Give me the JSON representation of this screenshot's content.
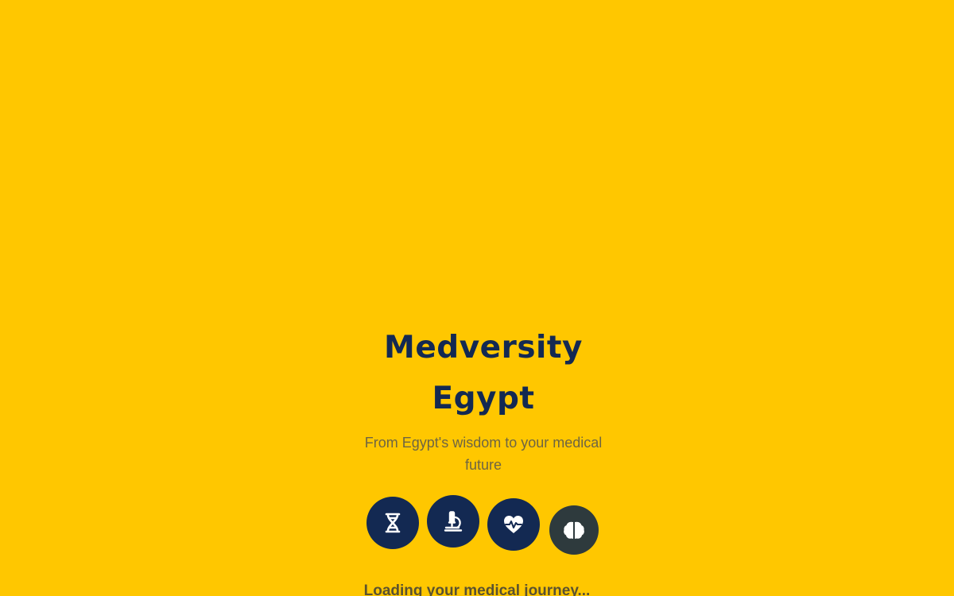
{
  "app": {
    "title_line1": "Medversity",
    "title_line2": "Egypt",
    "tagline_line1": "From Egypt's wisdom to your medical",
    "tagline_line2": "future"
  },
  "icons": [
    {
      "name": "dna-icon"
    },
    {
      "name": "microscope-icon"
    },
    {
      "name": "heartbeat-icon"
    },
    {
      "name": "brain-icon"
    }
  ],
  "status": {
    "loading_text": "Loading your medical journey..."
  },
  "colors": {
    "background": "#FFC700",
    "primary": "#132952",
    "muted_text": "#6E6543",
    "brain_circle": "#2E3A3D"
  }
}
